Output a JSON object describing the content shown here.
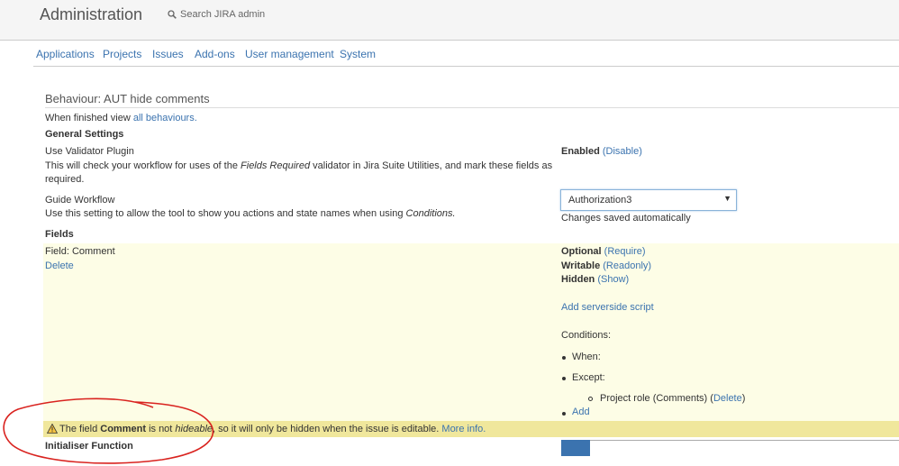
{
  "header": {
    "title": "Administration",
    "search_placeholder": "Search JIRA admin"
  },
  "nav": {
    "items": [
      "Applications",
      "Projects",
      "Issues",
      "Add-ons",
      "User management",
      "System"
    ]
  },
  "page": {
    "title": "Behaviour: AUT hide comments",
    "finished_prefix": "When finished view",
    "finished_link": "all behaviours."
  },
  "general_settings": {
    "heading": "General Settings",
    "validator": {
      "label": "Use Validator Plugin",
      "desc_1": "This will check your workflow for uses of the",
      "desc_em": "Fields Required",
      "desc_2": "validator in Jira Suite Utilities, and mark these fields as",
      "desc_3": "required.",
      "status": "Enabled",
      "toggle_link": "(Disable)"
    },
    "guide": {
      "label": "Guide Workflow",
      "desc_1": "Use this setting to allow the tool to show you actions and state names when using",
      "desc_em": "Conditions.",
      "select_value": "Authorization3",
      "saved_note": "Changes saved automatically"
    }
  },
  "fields": {
    "heading": "Fields",
    "field_label": "Field: Comment",
    "delete_link": "Delete",
    "optional": "Optional",
    "require_link": "(Require)",
    "writable": "Writable",
    "readonly_link": "(Readonly)",
    "hidden": "Hidden",
    "show_link": "(Show)",
    "add_script_link": "Add serverside script",
    "conditions_label": "Conditions:",
    "when_label": "When:",
    "except_label": "Except:",
    "role_text": "Project role (Comments)",
    "role_delete_open": "(",
    "role_delete_link": "Delete",
    "role_delete_close": ")",
    "add_link": "Add"
  },
  "warning": {
    "prefix": "The field",
    "field": "Comment",
    "mid": "is not",
    "em": "hideable",
    "suffix": ", so it will only be hidden when the issue is editable.",
    "link": "More info."
  },
  "initialiser": {
    "heading": "Initialiser Function"
  },
  "colors": {
    "link": "#3b73af",
    "fields_bg": "#fdfde6",
    "warning_bg": "#f0e79c",
    "annotation": "#d9231f"
  }
}
